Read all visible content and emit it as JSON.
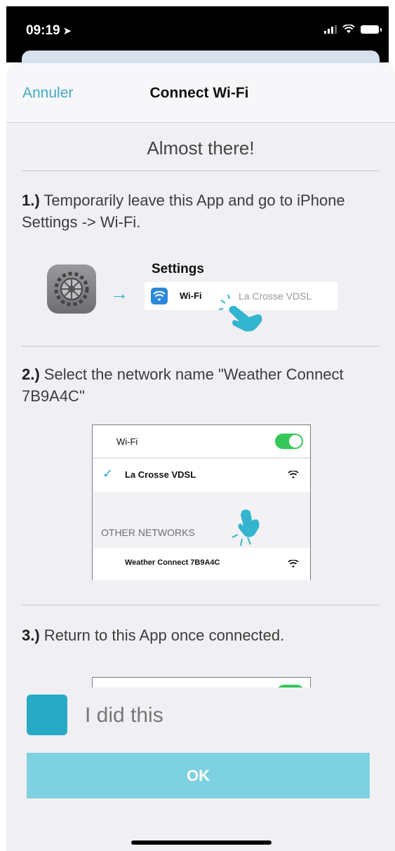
{
  "status": {
    "time": "09:19",
    "location_glyph": "➤"
  },
  "nav": {
    "cancel": "Annuler",
    "title": "Connect Wi-Fi"
  },
  "heading": "Almost there!",
  "steps": [
    {
      "num": "1.)",
      "text": " Temporarily leave this App and go to iPhone Settings -> Wi-Fi."
    },
    {
      "num": "2.)",
      "text": " Select the network name \"Weather Connect 7B9A4C\""
    },
    {
      "num": "3.)",
      "text": " Return to this App once connected."
    }
  ],
  "illustration1": {
    "arrow": "→",
    "settings_title": "Settings",
    "wifi_label": "Wi-Fi",
    "wifi_value": "La Crosse VDSL"
  },
  "illustration2": {
    "wifi_label": "Wi-Fi",
    "check": "✓",
    "current_network": "La Crosse VDSL",
    "other_networks": "OTHER NETWORKS",
    "target_network": "Weather Connect 7B9A4C"
  },
  "confirm": {
    "label": "I did this",
    "button": "OK"
  },
  "colors": {
    "accent": "#27a9c6",
    "button": "#7dd1e1",
    "toggle": "#35c759"
  }
}
